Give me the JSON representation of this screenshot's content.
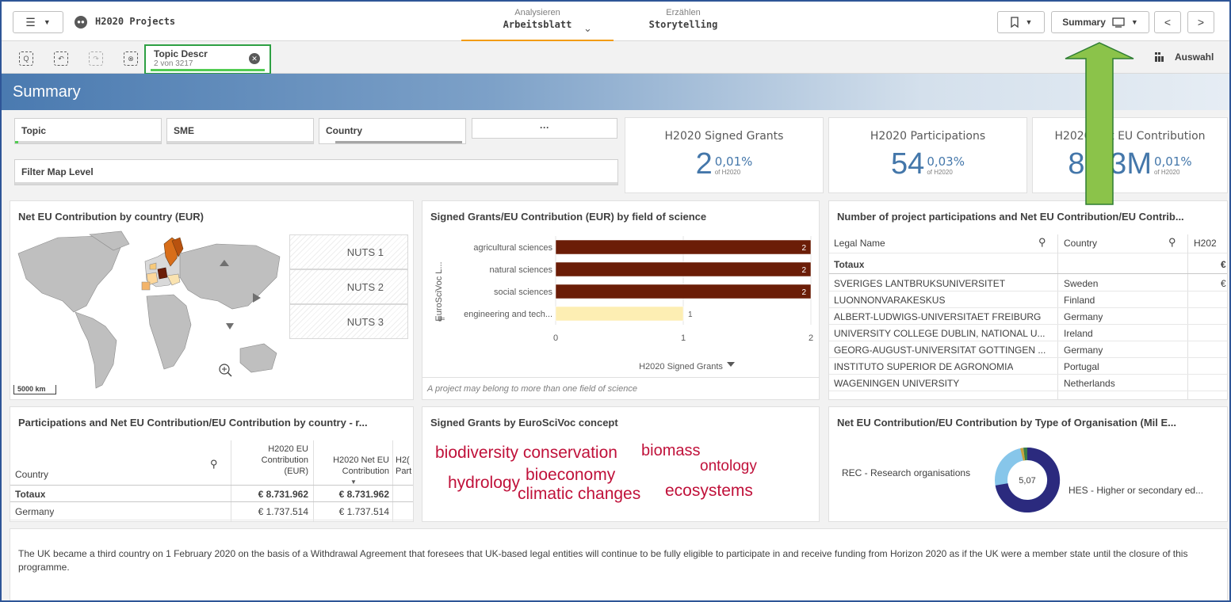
{
  "app": {
    "title": "H2020 Projects"
  },
  "modes": {
    "analyze_sub": "Analysieren",
    "analyze_main": "Arbeitsblatt",
    "story_sub": "Erzählen",
    "story_main": "Storytelling"
  },
  "toolbar": {
    "sheet_label": "Summary",
    "selections_label": "Auswahl"
  },
  "selection": {
    "field": "Topic Descr",
    "count": "2 von 3217"
  },
  "sheet_title": "Summary",
  "filters": {
    "topic": "Topic",
    "sme": "SME",
    "country": "Country",
    "more": "···",
    "map_level": "Filter Map Level"
  },
  "kpis": [
    {
      "title": "H2020 Signed Grants",
      "value": "2",
      "pct": "0,01%",
      "of": "of H2020"
    },
    {
      "title": "H2020 Participations",
      "value": "54",
      "pct": "0,03%",
      "of": "of H2020"
    },
    {
      "title": "H2020 Net EU Contribution",
      "value": "8,73M",
      "pct": "0,01%",
      "of": "of H2020"
    }
  ],
  "map_panel": {
    "title": "Net EU Contribution by country (EUR)",
    "nuts": [
      "NUTS 1",
      "NUTS 2",
      "NUTS 3"
    ],
    "scale": "5000 km"
  },
  "field_chart": {
    "title": "Signed Grants/EU Contribution (EUR) by field of science",
    "ylabel": "EuroSciVoc L...",
    "xlabel": "H2020 Signed Grants",
    "note": "A project may belong to more than one field of science",
    "colors": [
      "#6b1d07",
      "#6b1d07",
      "#6b1d07",
      "#fdeeb3"
    ]
  },
  "chart_data": {
    "type": "bar",
    "orientation": "horizontal",
    "categories": [
      "agricultural sciences",
      "natural sciences",
      "social sciences",
      "engineering and tech..."
    ],
    "values": [
      2,
      2,
      2,
      1
    ],
    "xlabel": "H2020 Signed Grants",
    "ylabel": "EuroSciVoc L...",
    "xlim": [
      0,
      2
    ],
    "xticks": [
      "0",
      "1",
      "2"
    ],
    "data_labels": [
      "2",
      "2",
      "2",
      "1"
    ]
  },
  "participations_table": {
    "title": "Number of project participations and Net EU Contribution/EU Contrib...",
    "headers": [
      "Legal Name",
      "Country",
      "H202"
    ],
    "total_label": "Totaux",
    "total_third": "€",
    "rows": [
      {
        "name": "SVERIGES LANTBRUKSUNIVERSITET",
        "country": "Sweden",
        "third": "€"
      },
      {
        "name": "LUONNONVARAKESKUS",
        "country": "Finland",
        "third": ""
      },
      {
        "name": "ALBERT-LUDWIGS-UNIVERSITAET FREIBURG",
        "country": "Germany",
        "third": ""
      },
      {
        "name": "UNIVERSITY COLLEGE DUBLIN, NATIONAL U...",
        "country": "Ireland",
        "third": ""
      },
      {
        "name": "GEORG-AUGUST-UNIVERSITAT GOTTINGEN ...",
        "country": "Germany",
        "third": ""
      },
      {
        "name": "INSTITUTO SUPERIOR DE AGRONOMIA",
        "country": "Portugal",
        "third": ""
      },
      {
        "name": "WAGENINGEN UNIVERSITY",
        "country": "Netherlands",
        "third": ""
      }
    ]
  },
  "country_table": {
    "title": "Participations and Net EU Contribution/EU Contribution by country - r...",
    "headers": [
      "Country",
      "H2020 EU Contribution (EUR)",
      "H2020 Net EU Contribution",
      "H2( Part"
    ],
    "total": {
      "label": "Totaux",
      "eu": "€ 8.731.962",
      "net": "€ 8.731.962"
    },
    "rows": [
      {
        "country": "Germany",
        "eu": "€ 1.737.514",
        "net": "€ 1.737.514"
      }
    ]
  },
  "wordcloud": {
    "title": "Signed Grants by EuroSciVoc concept",
    "words": [
      "biodiversity conservation",
      "biomass",
      "ontology",
      "hydrology",
      "bioeconomy",
      "climatic changes",
      "ecosystems"
    ]
  },
  "donut": {
    "title": "Net EU Contribution/EU Contribution by Type of Organisation (Mil E...",
    "center": "5,07",
    "label_left": "REC - Research organisations",
    "label_right": "HES - Higher or secondary ed...",
    "colors": [
      "#2b2a7e",
      "#87c6ea",
      "#3a7d44",
      "#c9a23c"
    ]
  },
  "footer_note": "The UK became a third country on 1 February 2020 on the basis of a Withdrawal Agreement that foresees that UK-based legal entities will continue to be fully eligible to participate in and receive funding from Horizon 2020 as if the UK were a member state until the closure of this programme."
}
